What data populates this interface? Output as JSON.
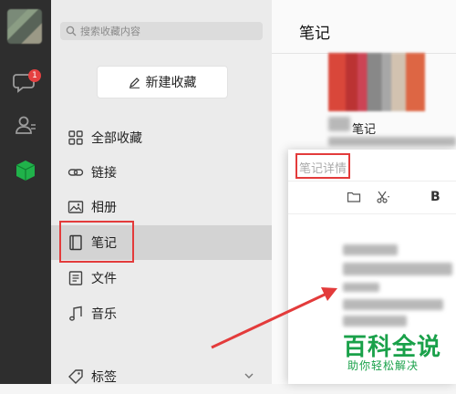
{
  "sidebar_rail": {
    "badge_count": "1",
    "icons": [
      "avatar",
      "chat-icon",
      "contacts-icon",
      "favorites-cube-icon"
    ],
    "active_color": "#20b24a"
  },
  "favorites": {
    "search_placeholder": "搜索收藏内容",
    "new_button_label": "新建收藏",
    "items": [
      {
        "label": "全部收藏",
        "icon": "grid-icon"
      },
      {
        "label": "链接",
        "icon": "link-icon"
      },
      {
        "label": "相册",
        "icon": "image-icon"
      },
      {
        "label": "笔记",
        "icon": "note-icon",
        "active": true
      },
      {
        "label": "文件",
        "icon": "file-icon"
      },
      {
        "label": "音乐",
        "icon": "music-icon"
      },
      {
        "label": "标签",
        "icon": "tag-icon"
      }
    ]
  },
  "main": {
    "title": "笔记",
    "list_item_title": "笔记"
  },
  "detail": {
    "title": "笔记详情",
    "toolbar_bold": "B"
  },
  "watermark": {
    "main": "百科全说",
    "sub": "助你轻松解决"
  },
  "colors": {
    "annotation_red": "#e33b3b",
    "watermark_green": "#1aa14a"
  }
}
